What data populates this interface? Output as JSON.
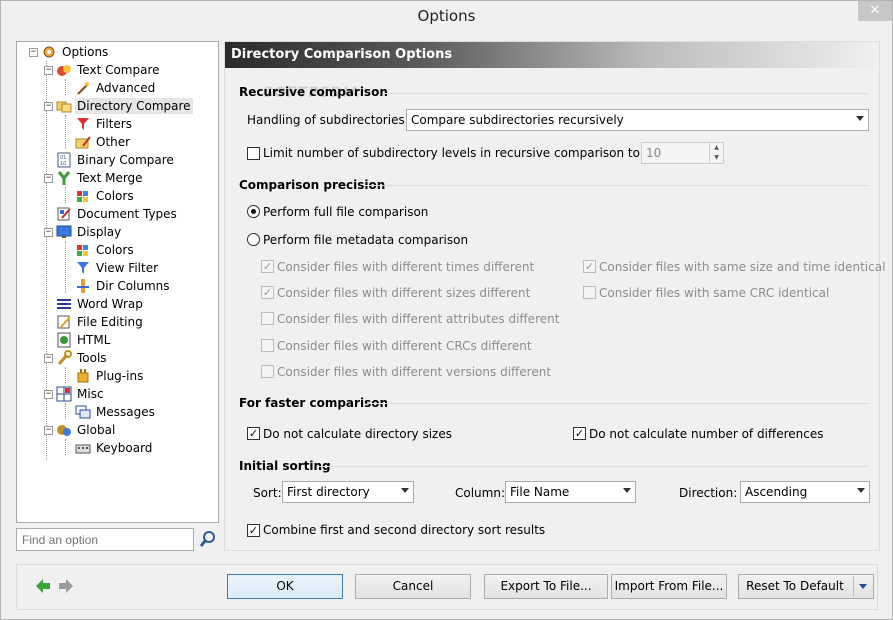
{
  "window": {
    "title": "Options"
  },
  "tree": {
    "items": [
      {
        "label": "Options",
        "level": 0,
        "icon": "options-gear-icon"
      },
      {
        "label": "Text Compare",
        "level": 1,
        "icon": "text-compare-icon"
      },
      {
        "label": "Advanced",
        "level": 2,
        "icon": "wand-icon"
      },
      {
        "label": "Directory Compare",
        "level": 1,
        "icon": "folders-icon",
        "selected": true
      },
      {
        "label": "Filters",
        "level": 2,
        "icon": "filter-icon"
      },
      {
        "label": "Other",
        "level": 2,
        "icon": "folder-edit-icon"
      },
      {
        "label": "Binary Compare",
        "level": 1,
        "icon": "binary-icon"
      },
      {
        "label": "Text Merge",
        "level": 1,
        "icon": "merge-icon"
      },
      {
        "label": "Colors",
        "level": 2,
        "icon": "palette-icon"
      },
      {
        "label": "Document Types",
        "level": 1,
        "icon": "document-types-icon"
      },
      {
        "label": "Display",
        "level": 1,
        "icon": "monitor-icon"
      },
      {
        "label": "Colors",
        "level": 2,
        "icon": "palette-icon"
      },
      {
        "label": "View Filter",
        "level": 2,
        "icon": "view-filter-icon"
      },
      {
        "label": "Dir Columns",
        "level": 2,
        "icon": "columns-icon"
      },
      {
        "label": "Word Wrap",
        "level": 1,
        "icon": "word-wrap-icon"
      },
      {
        "label": "File Editing",
        "level": 1,
        "icon": "file-edit-icon"
      },
      {
        "label": "HTML",
        "level": 1,
        "icon": "html-icon"
      },
      {
        "label": "Tools",
        "level": 1,
        "icon": "tools-icon"
      },
      {
        "label": "Plug-ins",
        "level": 2,
        "icon": "plugin-icon"
      },
      {
        "label": "Misc",
        "level": 1,
        "icon": "misc-icon"
      },
      {
        "label": "Messages",
        "level": 2,
        "icon": "messages-icon"
      },
      {
        "label": "Global",
        "level": 1,
        "icon": "global-icon"
      },
      {
        "label": "Keyboard",
        "level": 2,
        "icon": "keyboard-icon"
      }
    ]
  },
  "search": {
    "placeholder": "Find an option"
  },
  "pane": {
    "header": "Directory Comparison Options",
    "watermark": "SOFTPEDIA",
    "recursive": {
      "section": "Recursive comparison",
      "handling_label": "Handling of subdirectories:",
      "handling_value": "Compare subdirectories recursively",
      "limit_label": "Limit number of subdirectory levels in recursive comparison to",
      "limit_checked": false,
      "limit_value": "10"
    },
    "precision": {
      "section": "Comparison precision",
      "full_label": "Perform full file comparison",
      "metadata_label": "Perform file metadata comparison",
      "selected": "full",
      "options": [
        {
          "label": "Consider files with different times different",
          "checked": true
        },
        {
          "label": "Consider files with same size and time identical",
          "checked": true
        },
        {
          "label": "Consider files with different sizes different",
          "checked": true
        },
        {
          "label": "Consider files with same CRC identical",
          "checked": false
        },
        {
          "label": "Consider files with different attributes different",
          "checked": false
        },
        {
          "label": "Consider files with different CRCs different",
          "checked": false
        },
        {
          "label": "Consider files with different versions different",
          "checked": false
        }
      ]
    },
    "faster": {
      "section": "For faster comparison",
      "no_dir_sizes": "Do not calculate directory sizes",
      "no_dir_sizes_checked": true,
      "no_diff_count": "Do not calculate number of differences",
      "no_diff_count_checked": true
    },
    "sorting": {
      "section": "Initial sorting",
      "sort_label": "Sort:",
      "sort_value": "First directory",
      "column_label": "Column:",
      "column_value": "File Name",
      "direction_label": "Direction:",
      "direction_value": "Ascending",
      "combine_label": "Combine first and second directory sort results",
      "combine_checked": true
    }
  },
  "footer": {
    "ok": "OK",
    "cancel": "Cancel",
    "export": "Export To File...",
    "import": "Import From File...",
    "reset": "Reset To Default"
  },
  "colors": {
    "accent_green": "#3aa53a",
    "nav_disabled": "#9a9a9a",
    "check_mark": "#000000"
  }
}
